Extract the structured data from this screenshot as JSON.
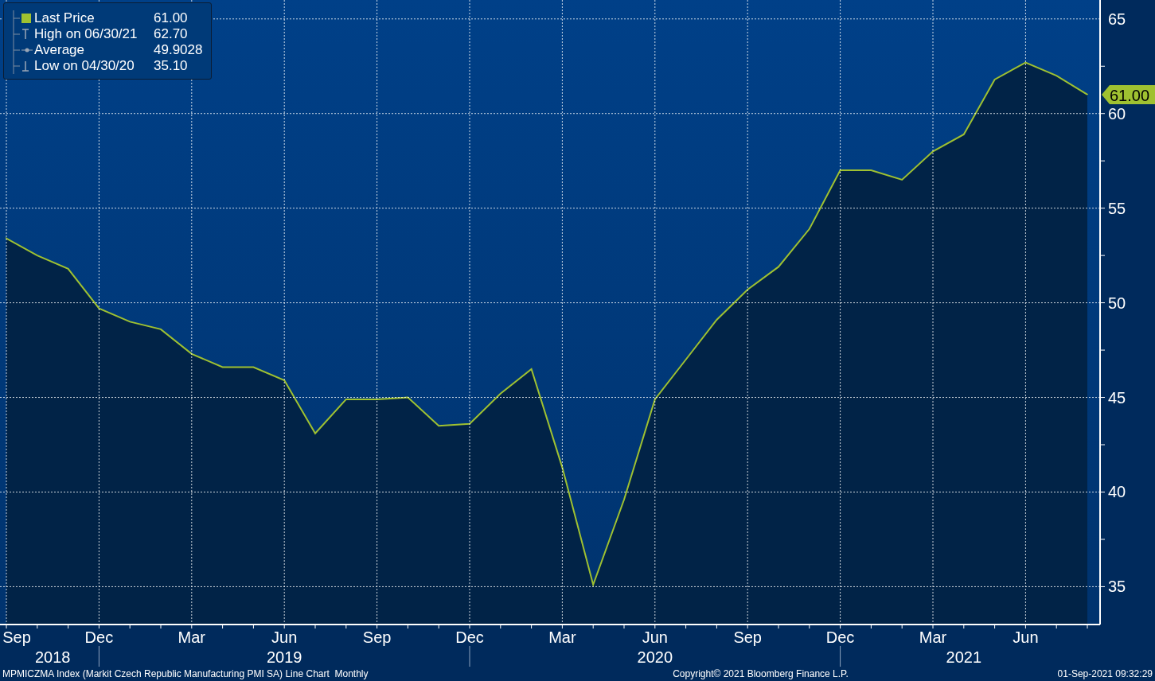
{
  "chart": {
    "chart_data": {
      "type": "area",
      "grid": true,
      "ylim": [
        33,
        66
      ],
      "yticks": [
        35,
        40,
        45,
        50,
        55,
        60,
        65
      ],
      "categories": [
        "Sep",
        null,
        null,
        "Dec",
        null,
        null,
        "Mar",
        null,
        null,
        "Jun",
        null,
        null,
        "Sep",
        null,
        null,
        "Dec",
        null,
        null,
        "Mar",
        null,
        null,
        "Jun",
        null,
        null,
        "Sep",
        null,
        null,
        "Dec",
        null,
        null,
        "Mar",
        null,
        null,
        "Jun",
        null,
        null
      ],
      "series": [
        {
          "color": "#9fc131",
          "values": [
            53.4,
            52.5,
            51.8,
            49.7,
            49.0,
            48.6,
            47.3,
            46.6,
            46.6,
            45.9,
            43.1,
            44.9,
            44.9,
            45.0,
            43.5,
            43.6,
            45.2,
            46.5,
            41.3,
            35.1,
            39.6,
            44.9,
            47.0,
            49.1,
            50.7,
            51.9,
            53.9,
            57.0,
            57.0,
            56.5,
            58.0,
            58.9,
            61.8,
            62.7,
            62.0,
            61.0
          ]
        }
      ],
      "annotations": [
        "61.00"
      ]
    },
    "year_labels": [
      "2018",
      "2019",
      "2020",
      "2021"
    ]
  },
  "legend": [
    {
      "kind": "last",
      "label": "Last Price",
      "value": "61.00"
    },
    {
      "kind": "high",
      "label": "High on 06/30/21",
      "value": "62.70"
    },
    {
      "kind": "average",
      "label": "Average",
      "value": "49.9028"
    },
    {
      "kind": "low",
      "label": "Low on 04/30/20",
      "value": "35.10"
    }
  ],
  "footer": {
    "description": "MPMICZMA Index (Markit Czech Republic Manufacturing PMI SA) Line Chart  Monthly",
    "copyright": "Copyright© 2021 Bloomberg Finance L.P.",
    "timestamp": "01-Sep-2021 09:32:29"
  }
}
